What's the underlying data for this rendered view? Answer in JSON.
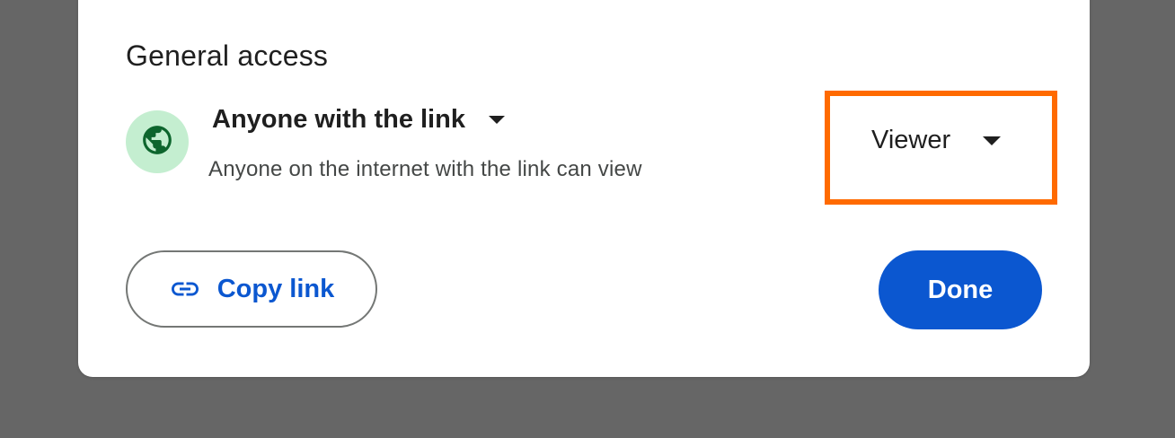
{
  "general_access": {
    "title": "General access",
    "link_access": {
      "label": "Anyone with the link",
      "description": "Anyone on the internet with the link can view",
      "icon": "globe-icon"
    },
    "role": {
      "label": "Viewer",
      "highlight_color": "#ff6a00"
    }
  },
  "actions": {
    "copy_link_label": "Copy link",
    "done_label": "Done"
  },
  "colors": {
    "accent": "#0b57d0",
    "globe_bg": "#c4eed0",
    "globe_fg": "#0d652d"
  }
}
